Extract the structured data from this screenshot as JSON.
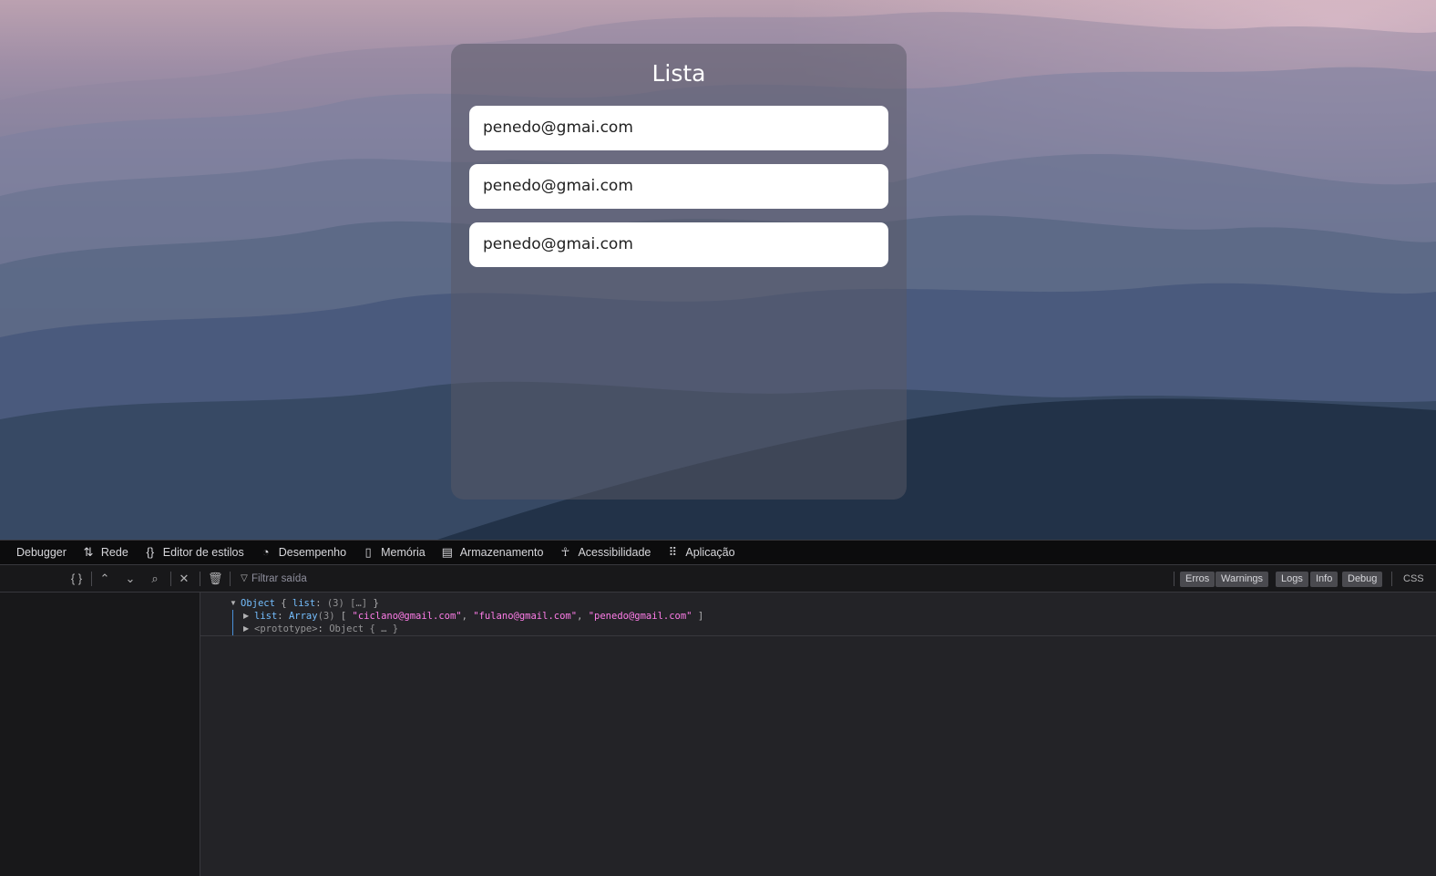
{
  "page": {
    "card_title": "Lista",
    "items": [
      "penedo@gmai.com",
      "penedo@gmai.com",
      "penedo@gmai.com"
    ]
  },
  "devtools": {
    "tabs": [
      {
        "label": "Debugger",
        "icon": "debugger-icon"
      },
      {
        "label": "Rede",
        "icon": "network-icon"
      },
      {
        "label": "Editor de estilos",
        "icon": "braces-icon"
      },
      {
        "label": "Desempenho",
        "icon": "gauge-icon"
      },
      {
        "label": "Memória",
        "icon": "memory-chip-icon"
      },
      {
        "label": "Armazenamento",
        "icon": "storage-icon"
      },
      {
        "label": "Acessibilidade",
        "icon": "accessibility-icon"
      },
      {
        "label": "Aplicação",
        "icon": "grid-icon"
      }
    ],
    "toolbar": {
      "pretty_print": "{ }",
      "filter_placeholder": "Filtrar saída",
      "levels": [
        "Erros",
        "Warnings",
        "Logs",
        "Info",
        "Debug"
      ],
      "css_label": "CSS"
    },
    "console": {
      "line1": {
        "key_obj": "Object",
        "open": " { ",
        "key": "list",
        "colon": ": ",
        "summary": "(3) […]",
        "close": " }"
      },
      "line2": {
        "key": "list",
        "colon": ": ",
        "type": "Array",
        "count": "(3)",
        "open": " [ ",
        "items": [
          "\"ciclano@gmail.com\"",
          "\"fulano@gmail.com\"",
          "\"penedo@gmail.com\""
        ],
        "close": " ]"
      },
      "line3": {
        "key": "<prototype>",
        "colon": ": ",
        "value": "Object { … }"
      }
    }
  }
}
